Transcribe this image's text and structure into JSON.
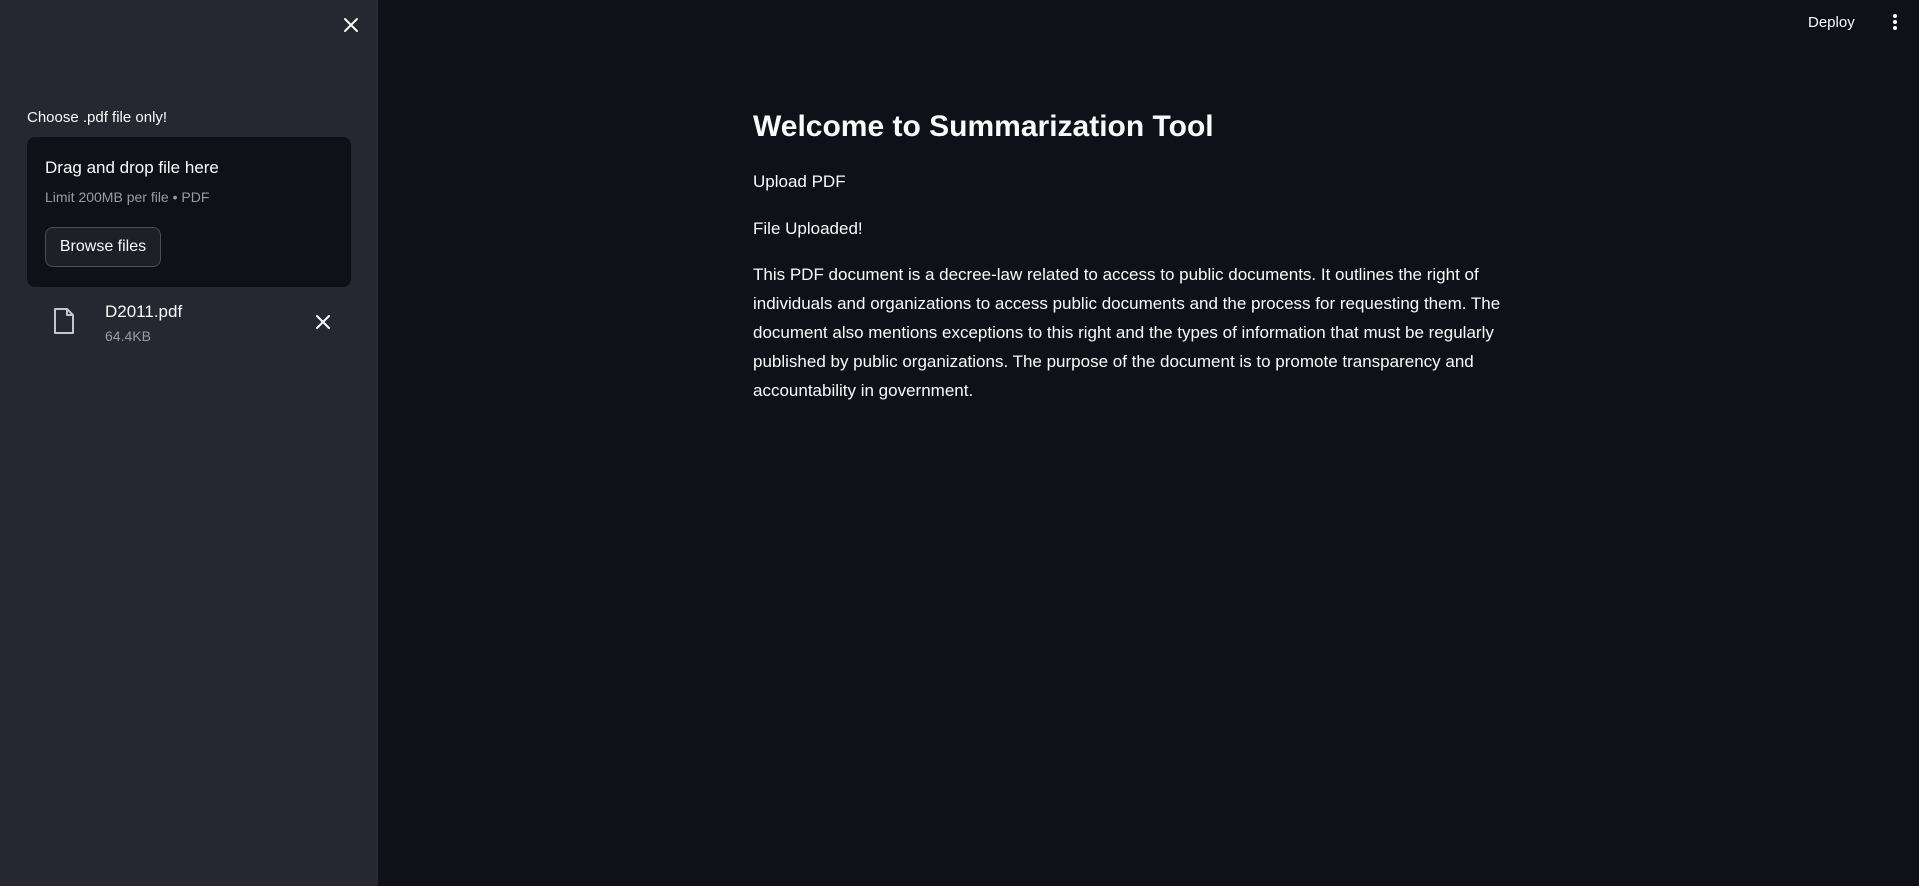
{
  "sidebar": {
    "close_icon": "close-icon",
    "uploader": {
      "label": "Choose .pdf file only!",
      "dropzone_title": "Drag and drop file here",
      "dropzone_limit": "Limit 200MB per file • PDF",
      "browse_label": "Browse files"
    },
    "file": {
      "icon": "file-icon",
      "name": "D2011.pdf",
      "size": "64.4KB",
      "remove_icon": "close-icon"
    }
  },
  "header": {
    "deploy_label": "Deploy",
    "menu_icon": "more-vertical-icon"
  },
  "main": {
    "title": "Welcome to Summarization Tool",
    "upload_text": "Upload PDF",
    "status_text": "File Uploaded!",
    "summary": "This PDF document is a decree-law related to access to public documents. It outlines the right of individuals and organizations to access public documents and the process for requesting them. The document also mentions exceptions to this right and the types of information that must be regularly published by public organizations. The purpose of the document is to promote transparency and accountability in government."
  },
  "colors": {
    "background": "#0e1117",
    "sidebar": "#262730",
    "text": "#fafafa",
    "muted_text": "#9a9ca3"
  }
}
